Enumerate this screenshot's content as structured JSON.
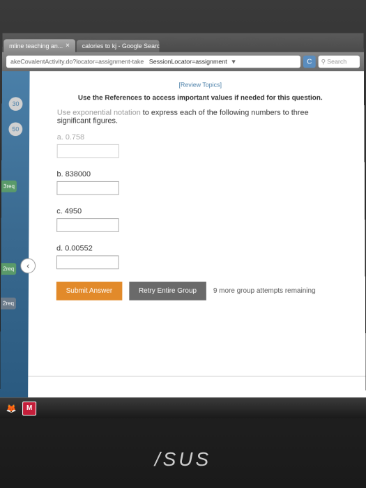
{
  "browser": {
    "tabs": [
      {
        "label": "mline teaching an..."
      },
      {
        "label": "calories to kj - Google Search"
      }
    ],
    "url_prefix": "akeCovalentActivity.do?locator=assignment-take",
    "url_locator": "SessionLocator=assignment",
    "reload_icon": "C",
    "search_placeholder": "Search"
  },
  "rail": {
    "badges": [
      "30",
      "50"
    ],
    "tags": [
      "3req",
      "2req",
      "2req"
    ]
  },
  "nav_arrow": "‹",
  "page": {
    "review_link": "[Review Topics]",
    "references_instruction": "Use the References to access important values if needed for this question.",
    "question": {
      "lead_faded": "Use exponential notation",
      "lead_rest": " to express each of the following numbers to three significant figures."
    },
    "parts": [
      {
        "label": "a. 0.758",
        "faded": true
      },
      {
        "label": "b. 838000",
        "faded": false
      },
      {
        "label": "c. 4950",
        "faded": false
      },
      {
        "label": "d. 0.00552",
        "faded": false
      }
    ],
    "submit_label": "Submit Answer",
    "retry_label": "Retry Entire Group",
    "attempts_text": "9 more group attempts remaining"
  },
  "taskbar": {
    "firefox": "🦊",
    "mcafee": "M"
  },
  "laptop_brand": "/SUS"
}
